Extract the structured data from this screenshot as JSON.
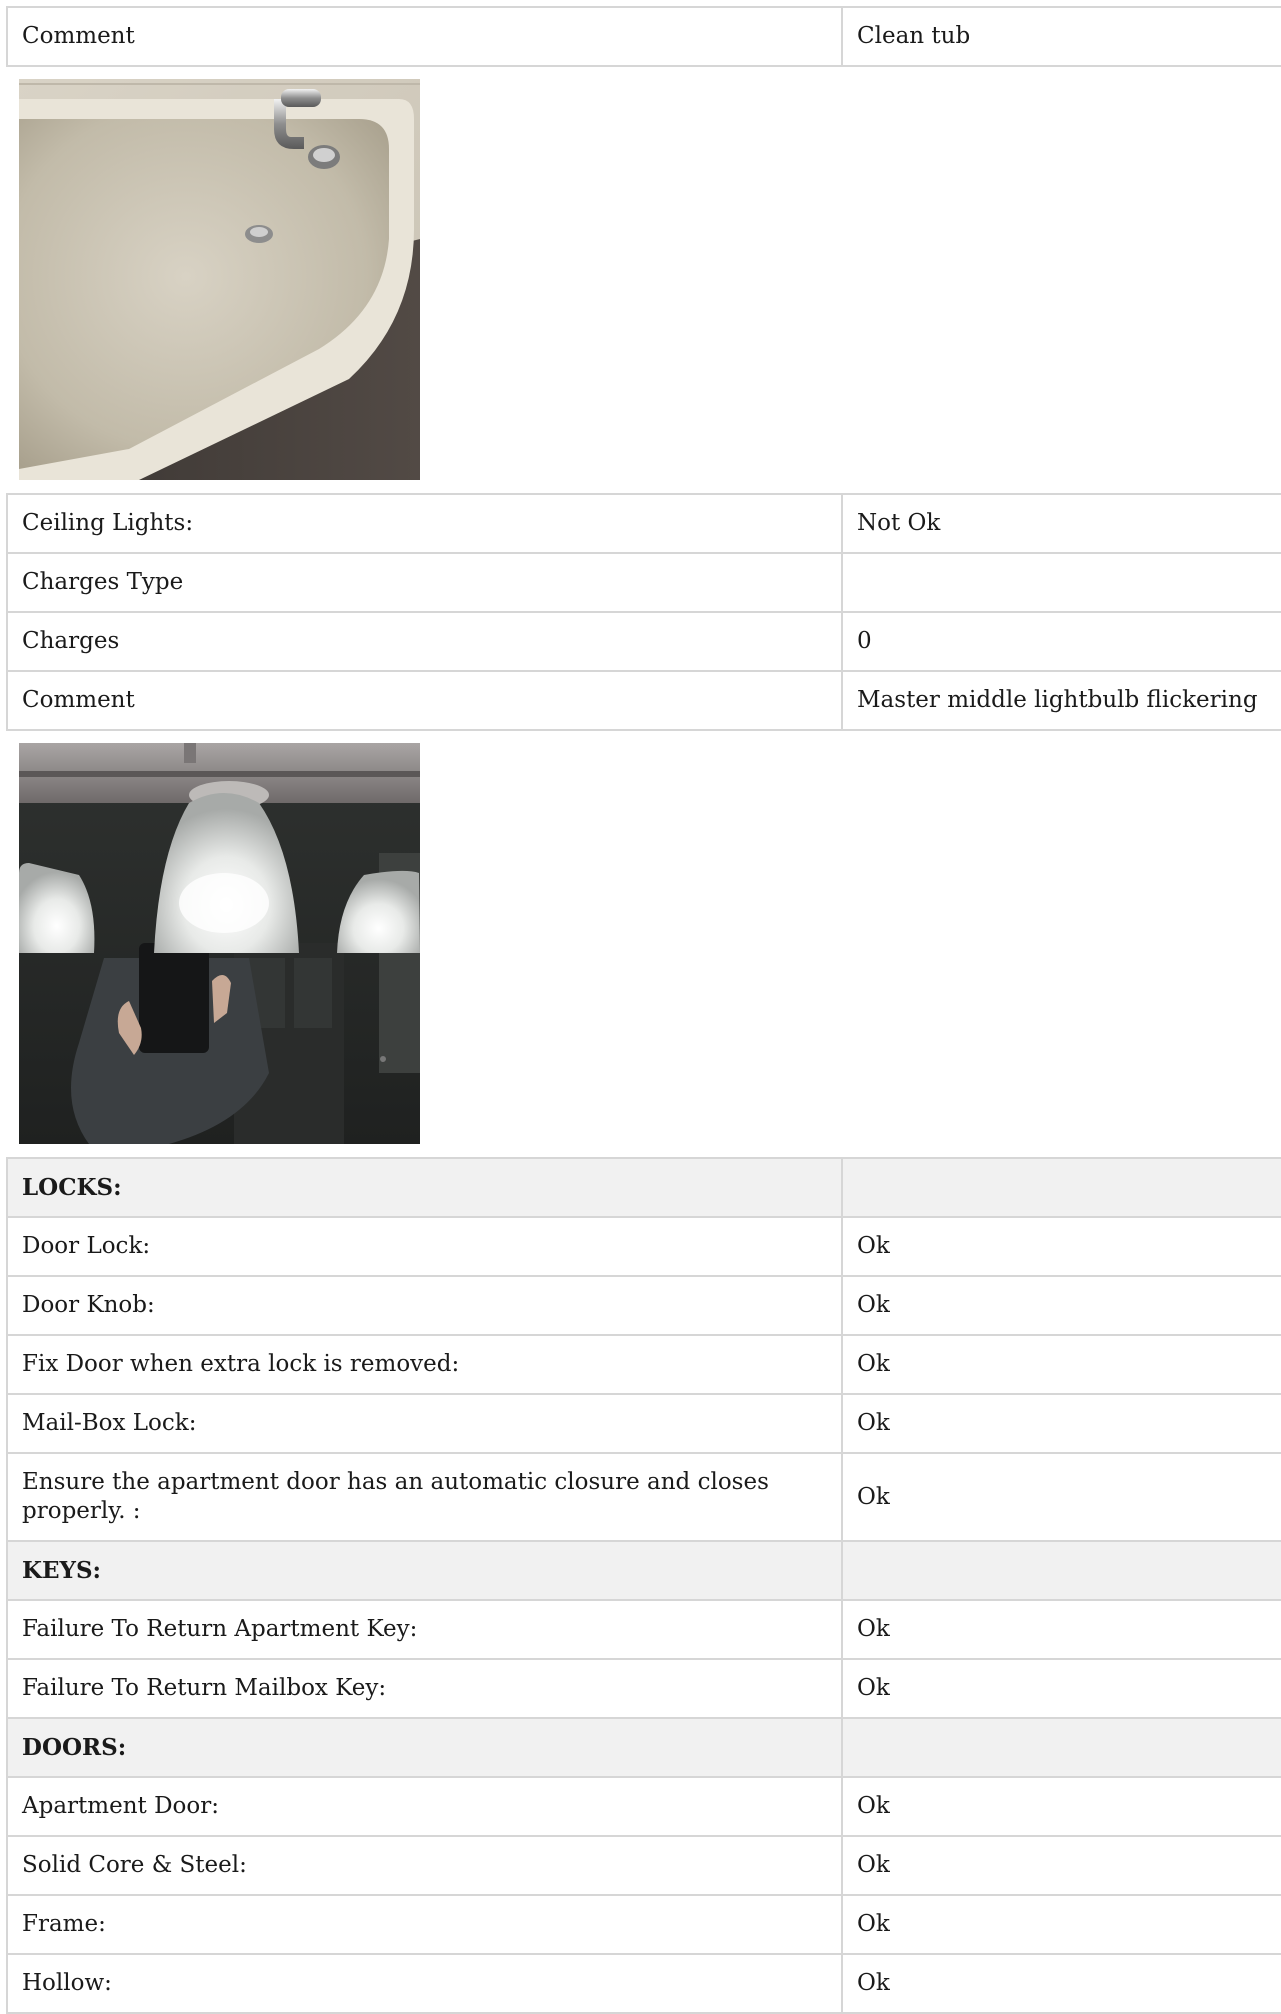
{
  "block1": {
    "rows": [
      {
        "label": "Comment",
        "value": "Clean tub"
      }
    ]
  },
  "photo_tub": {
    "icon": "bathtub-photo"
  },
  "block2": {
    "rows": [
      {
        "label": "Ceiling Lights:",
        "value": "Not Ok"
      },
      {
        "label": "Charges Type",
        "value": ""
      },
      {
        "label": "Charges",
        "value": "0"
      },
      {
        "label": "Comment",
        "value": "Master middle lightbulb flickering"
      }
    ]
  },
  "photo_lights": {
    "icon": "ceiling-light-photo"
  },
  "block3": {
    "rows": [
      {
        "label": "LOCKS:",
        "value": ""
      },
      {
        "label": "Door Lock:",
        "value": "Ok"
      },
      {
        "label": "Door Knob:",
        "value": "Ok"
      },
      {
        "label": "Fix Door when extra lock is removed:",
        "value": "Ok"
      },
      {
        "label": "Mail-Box Lock:",
        "value": "Ok"
      },
      {
        "label": "Ensure the apartment door has an automatic closure and closes properly. :",
        "value": "Ok"
      },
      {
        "label": "KEYS:",
        "value": ""
      },
      {
        "label": "Failure To Return Apartment Key:",
        "value": "Ok"
      },
      {
        "label": "Failure To Return Mailbox Key:",
        "value": "Ok"
      },
      {
        "label": "DOORS:",
        "value": ""
      },
      {
        "label": "Apartment Door:",
        "value": "Ok"
      },
      {
        "label": "Solid Core & Steel:",
        "value": "Ok"
      },
      {
        "label": "Frame:",
        "value": "Ok"
      },
      {
        "label": "Hollow:",
        "value": "Ok"
      }
    ]
  }
}
